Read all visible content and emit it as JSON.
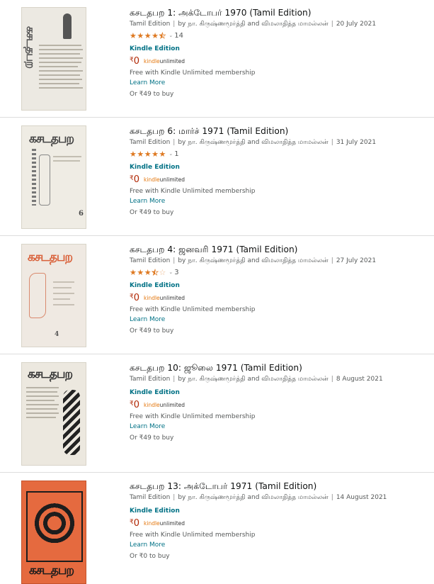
{
  "common": {
    "author_prefix": "by",
    "author1": "நா. கிருஷ்ணமூர்த்தி",
    "author_join": "and",
    "author2": "விமலாதித்த மாமல்லன்",
    "format": "Kindle Edition",
    "price_currency": "₹",
    "price_value": "0",
    "ku_kindle": "kindle",
    "ku_unlimited": "unlimited",
    "free_text": "Free with Kindle Unlimited membership",
    "learn_more": "Learn More",
    "separator": "|",
    "chevron": "⌄",
    "colors": {
      "star": "#de7921",
      "link": "#007185",
      "price": "#b12704"
    }
  },
  "results": [
    {
      "title": "கசடதபற 1: அக்டோபர் 1970",
      "edition_suffix": "(Tamil Edition)",
      "binding": "Tamil Edition",
      "date": "20 July 2021",
      "rating": 4.5,
      "rating_count": "14",
      "buy_text": "Or ₹49 to buy"
    },
    {
      "title": "கசடதபற 6: மார்ச் 1971",
      "edition_suffix": "(Tamil Edition)",
      "binding": "Tamil Edition",
      "date": "31 July 2021",
      "rating": 5,
      "rating_count": "1",
      "buy_text": "Or ₹49 to buy"
    },
    {
      "title": "கசடதபற 4: ஜனவரி 1971",
      "edition_suffix": "(Tamil Edition)",
      "binding": "Tamil Edition",
      "date": "27 July 2021",
      "rating": 3.5,
      "rating_count": "3",
      "buy_text": "Or ₹49 to buy"
    },
    {
      "title": "கசடதபற 10: ஜூலை 1971",
      "edition_suffix": "(Tamil Edition)",
      "binding": "Tamil Edition",
      "date": "8 August 2021",
      "rating": null,
      "rating_count": "",
      "buy_text": "Or ₹49 to buy"
    },
    {
      "title": "கசடதபற 13: அக்டோபர் 1971",
      "edition_suffix": "(Tamil Edition)",
      "binding": "Tamil Edition",
      "date": "14 August 2021",
      "rating": null,
      "rating_count": "",
      "buy_text": "Or ₹0 to buy"
    }
  ]
}
